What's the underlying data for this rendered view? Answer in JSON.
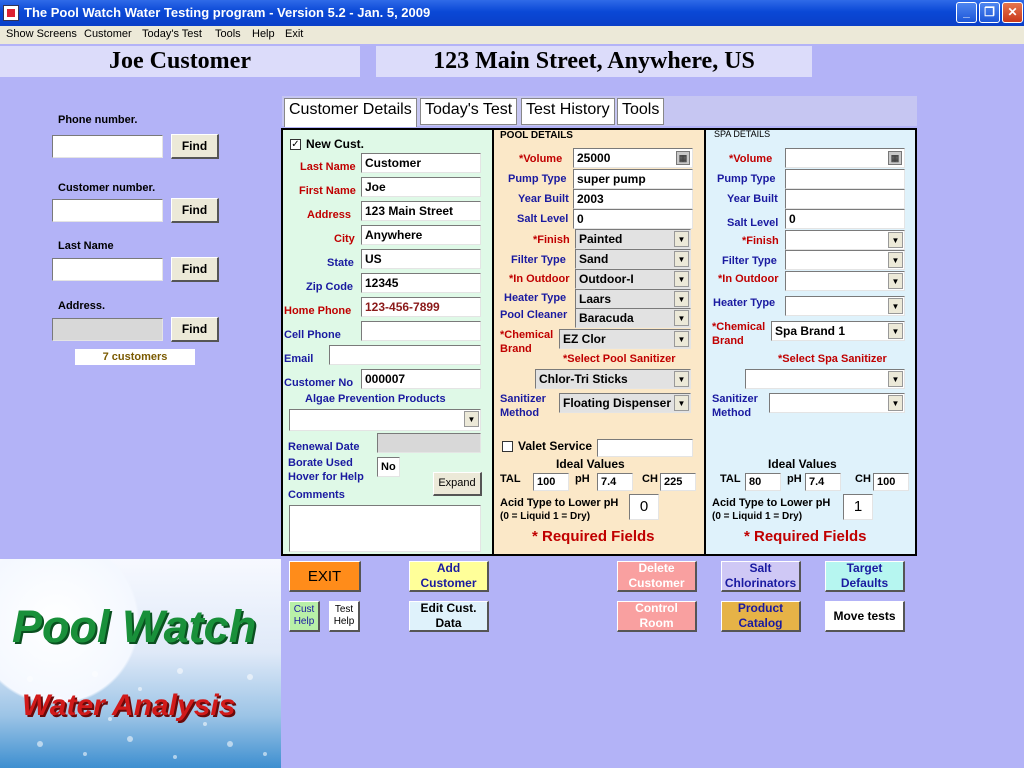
{
  "window": {
    "title": "The Pool Watch Water Testing program - Version 5.2 - Jan. 5, 2009"
  },
  "menu": [
    "Show Screens",
    "Customer",
    "Today's Test",
    "Tools",
    "Help",
    "Exit"
  ],
  "banner": {
    "customer_name": "Joe Customer",
    "address": "123 Main Street, Anywhere, US"
  },
  "search": {
    "phone_label": "Phone number.",
    "customer_no_label": "Customer number.",
    "last_name_label": "Last Name",
    "address_label": "Address.",
    "find_label": "Find",
    "count": "7 customers"
  },
  "tabs": [
    "Customer Details",
    "Today's Test",
    "Test History",
    "Tools"
  ],
  "customer": {
    "new_cust_label": "New Cust.",
    "new_cust_checked": "✓",
    "last_name_label": "Last Name",
    "last_name": "Customer",
    "first_name_label": "First Name",
    "first_name": "Joe",
    "address_label": "Address",
    "address": "123 Main Street",
    "city_label": "City",
    "city": "Anywhere",
    "state_label": "State",
    "state": "US",
    "zip_label": "Zip Code",
    "zip": "12345",
    "home_phone_label": "Home Phone",
    "home_phone": "123-456-7899",
    "cell_phone_label": "Cell Phone",
    "cell_phone": "",
    "email_label": "Email",
    "email": "",
    "customer_no_label": "Customer No",
    "customer_no": "000007",
    "algae_label": "Algae Prevention Products",
    "algae": "",
    "renewal_label": "Renewal Date",
    "renewal": "",
    "borate_label": "Borate Used",
    "borate": "No",
    "hover_help": "Hover for Help",
    "expand_label": "Expand",
    "comments_label": "Comments",
    "comments": ""
  },
  "pool": {
    "header": "POOL DETAILS",
    "volume_label": "*Volume",
    "volume": "25000",
    "pump_label": "Pump Type",
    "pump": "super pump",
    "year_label": "Year Built",
    "year": "2003",
    "salt_label": "Salt Level",
    "salt": "0",
    "finish_label": "*Finish",
    "finish": "Painted",
    "filter_label": "Filter Type",
    "filter": "Sand",
    "outdoor_label": "*In Outdoor",
    "outdoor": "Outdoor-I",
    "heater_label": "Heater Type",
    "heater": "Laars",
    "cleaner_label": "Pool Cleaner",
    "cleaner": "Baracuda",
    "chem_label_1": "*Chemical",
    "chem_label_2": "Brand",
    "chem": "EZ Clor",
    "sanitizer_prompt": "*Select Pool Sanitizer",
    "sanitizer": "Chlor-Tri Sticks",
    "method_label_1": "Sanitizer",
    "method_label_2": "Method",
    "method": "Floating Dispenser",
    "valet_label": "Valet Service",
    "valet": "",
    "ideal_label": "Ideal Values",
    "tal_label": "TAL",
    "tal": "100",
    "ph_label": "pH",
    "ph": "7.4",
    "ch_label": "CH",
    "ch": "225",
    "acid_label_1": "Acid Type to Lower pH",
    "acid_label_2": "(0 = Liquid 1 = Dry)",
    "acid": "0",
    "required": "* Required Fields"
  },
  "spa": {
    "header": "SPA DETAILS",
    "volume_label": "*Volume",
    "volume": "",
    "pump_label": "Pump Type",
    "pump": "",
    "year_label": "Year Built",
    "year": "",
    "salt_label": "Salt Level",
    "salt": "0",
    "finish_label": "*Finish",
    "finish": "",
    "filter_label": "Filter Type",
    "filter": "",
    "outdoor_label": "*In Outdoor",
    "outdoor": "",
    "heater_label": "Heater Type",
    "heater": "",
    "chem_label_1": "*Chemical",
    "chem_label_2": "Brand",
    "chem": "Spa Brand 1",
    "sanitizer_prompt": "*Select Spa Sanitizer",
    "sanitizer": "",
    "method_label_1": "Sanitizer",
    "method_label_2": "Method",
    "method": "",
    "ideal_label": "Ideal Values",
    "tal_label": "TAL",
    "tal": "80",
    "ph_label": "pH",
    "ph": "7.4",
    "ch_label": "CH",
    "ch": "100",
    "acid_label_1": "Acid Type to Lower pH",
    "acid_label_2": "(0 = Liquid 1 = Dry)",
    "acid": "1",
    "required": "* Required Fields"
  },
  "buttons": {
    "exit": "EXIT",
    "add_1": "Add",
    "add_2": "Customer",
    "delete_1": "Delete",
    "delete_2": "Customer",
    "salt_1": "Salt",
    "salt_2": "Chlorinators",
    "target_1": "Target",
    "target_2": "Defaults",
    "cust_help_1": "Cust",
    "cust_help_2": "Help",
    "test_help_1": "Test",
    "test_help_2": "Help",
    "edit_1": "Edit Cust.",
    "edit_2": "Data",
    "control_1": "Control",
    "control_2": "Room",
    "product_1": "Product",
    "product_2": "Catalog",
    "move": "Move tests"
  },
  "logo": {
    "line1": "Pool Watch",
    "line2": "Water Analysis"
  },
  "colors": {
    "label_red": "#c00000",
    "label_blue": "#1a1aa0",
    "customer_panel": "#dff9e7",
    "pool_panel": "#fbe8c8",
    "spa_panel": "#dff2fb",
    "exit_orange": "#ff8c1a",
    "add_yellow": "#ffff99",
    "delete_pink": "#f9a0a0",
    "salt_lilac": "#cfc8f5",
    "target_aqua": "#b6f6f0",
    "product_gold": "#e6b347"
  }
}
